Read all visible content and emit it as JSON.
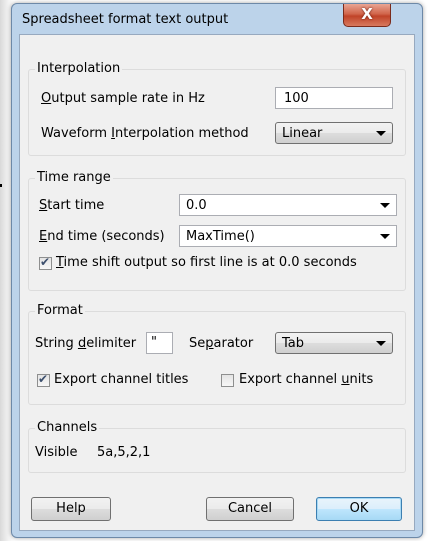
{
  "window": {
    "title": "Spreadsheet format text output",
    "close_glyph": "X"
  },
  "interpolation": {
    "legend": "Interpolation",
    "sample_rate_label": "Output sample rate in Hz",
    "sample_rate_value": "100",
    "method_label": "Waveform Interpolation method",
    "method_value": "Linear"
  },
  "time_range": {
    "legend": "Time range",
    "start_label": "Start time",
    "start_value": "0.0",
    "end_label": "End time (seconds)",
    "end_value": "MaxTime()",
    "time_shift_label": "Time shift output so first line is at 0.0 seconds",
    "time_shift_checked": true
  },
  "format": {
    "legend": "Format",
    "string_delimiter_label": "String delimiter",
    "string_delimiter_value": "\"",
    "separator_label": "Separator",
    "separator_value": "Tab",
    "export_titles_label": "Export channel titles",
    "export_titles_checked": true,
    "export_units_label": "Export channel units",
    "export_units_checked": false
  },
  "channels": {
    "legend": "Channels",
    "visible_label": "Visible",
    "visible_value": "5a,5,2,1"
  },
  "buttons": {
    "help": "Help",
    "cancel": "Cancel",
    "ok": "OK"
  }
}
